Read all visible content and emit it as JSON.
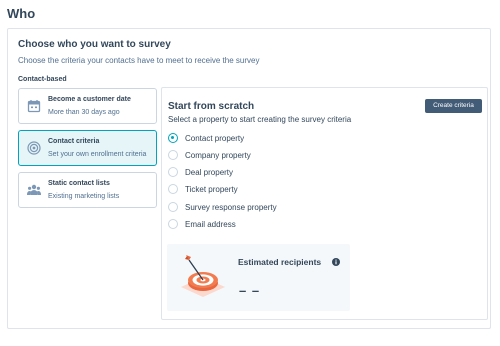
{
  "page": {
    "title": "Who"
  },
  "survey_card": {
    "title": "Choose who you want to survey",
    "subtitle": "Choose the criteria your contacts have to meet to receive the survey",
    "section_label": "Contact-based",
    "options": [
      {
        "title": "Become a customer date",
        "subtitle": "More than 30 days ago",
        "icon": "calendar-icon",
        "selected": false
      },
      {
        "title": "Contact criteria",
        "subtitle": "Set your own enrollment criteria",
        "icon": "target-icon",
        "selected": true
      },
      {
        "title": "Static contact lists",
        "subtitle": "Existing marketing lists",
        "icon": "contacts-icon",
        "selected": false
      }
    ]
  },
  "criteria_panel": {
    "title": "Start from scratch",
    "subtitle": "Select a property to start creating the survey criteria",
    "create_button": "Create criteria",
    "properties": [
      {
        "label": "Contact property",
        "checked": true
      },
      {
        "label": "Company property",
        "checked": false
      },
      {
        "label": "Deal property",
        "checked": false
      },
      {
        "label": "Ticket property",
        "checked": false
      },
      {
        "label": "Survey response property",
        "checked": false
      },
      {
        "label": "Email address",
        "checked": false
      }
    ]
  },
  "estimate": {
    "title": "Estimated recipients",
    "value": "– –",
    "icon": "info-icon",
    "illustration": "target-dartboard-illustration"
  },
  "colors": {
    "accent": "#00a4bd",
    "selected_bg": "#e5f5f8",
    "button_bg": "#425b76",
    "text": "#33475b"
  }
}
